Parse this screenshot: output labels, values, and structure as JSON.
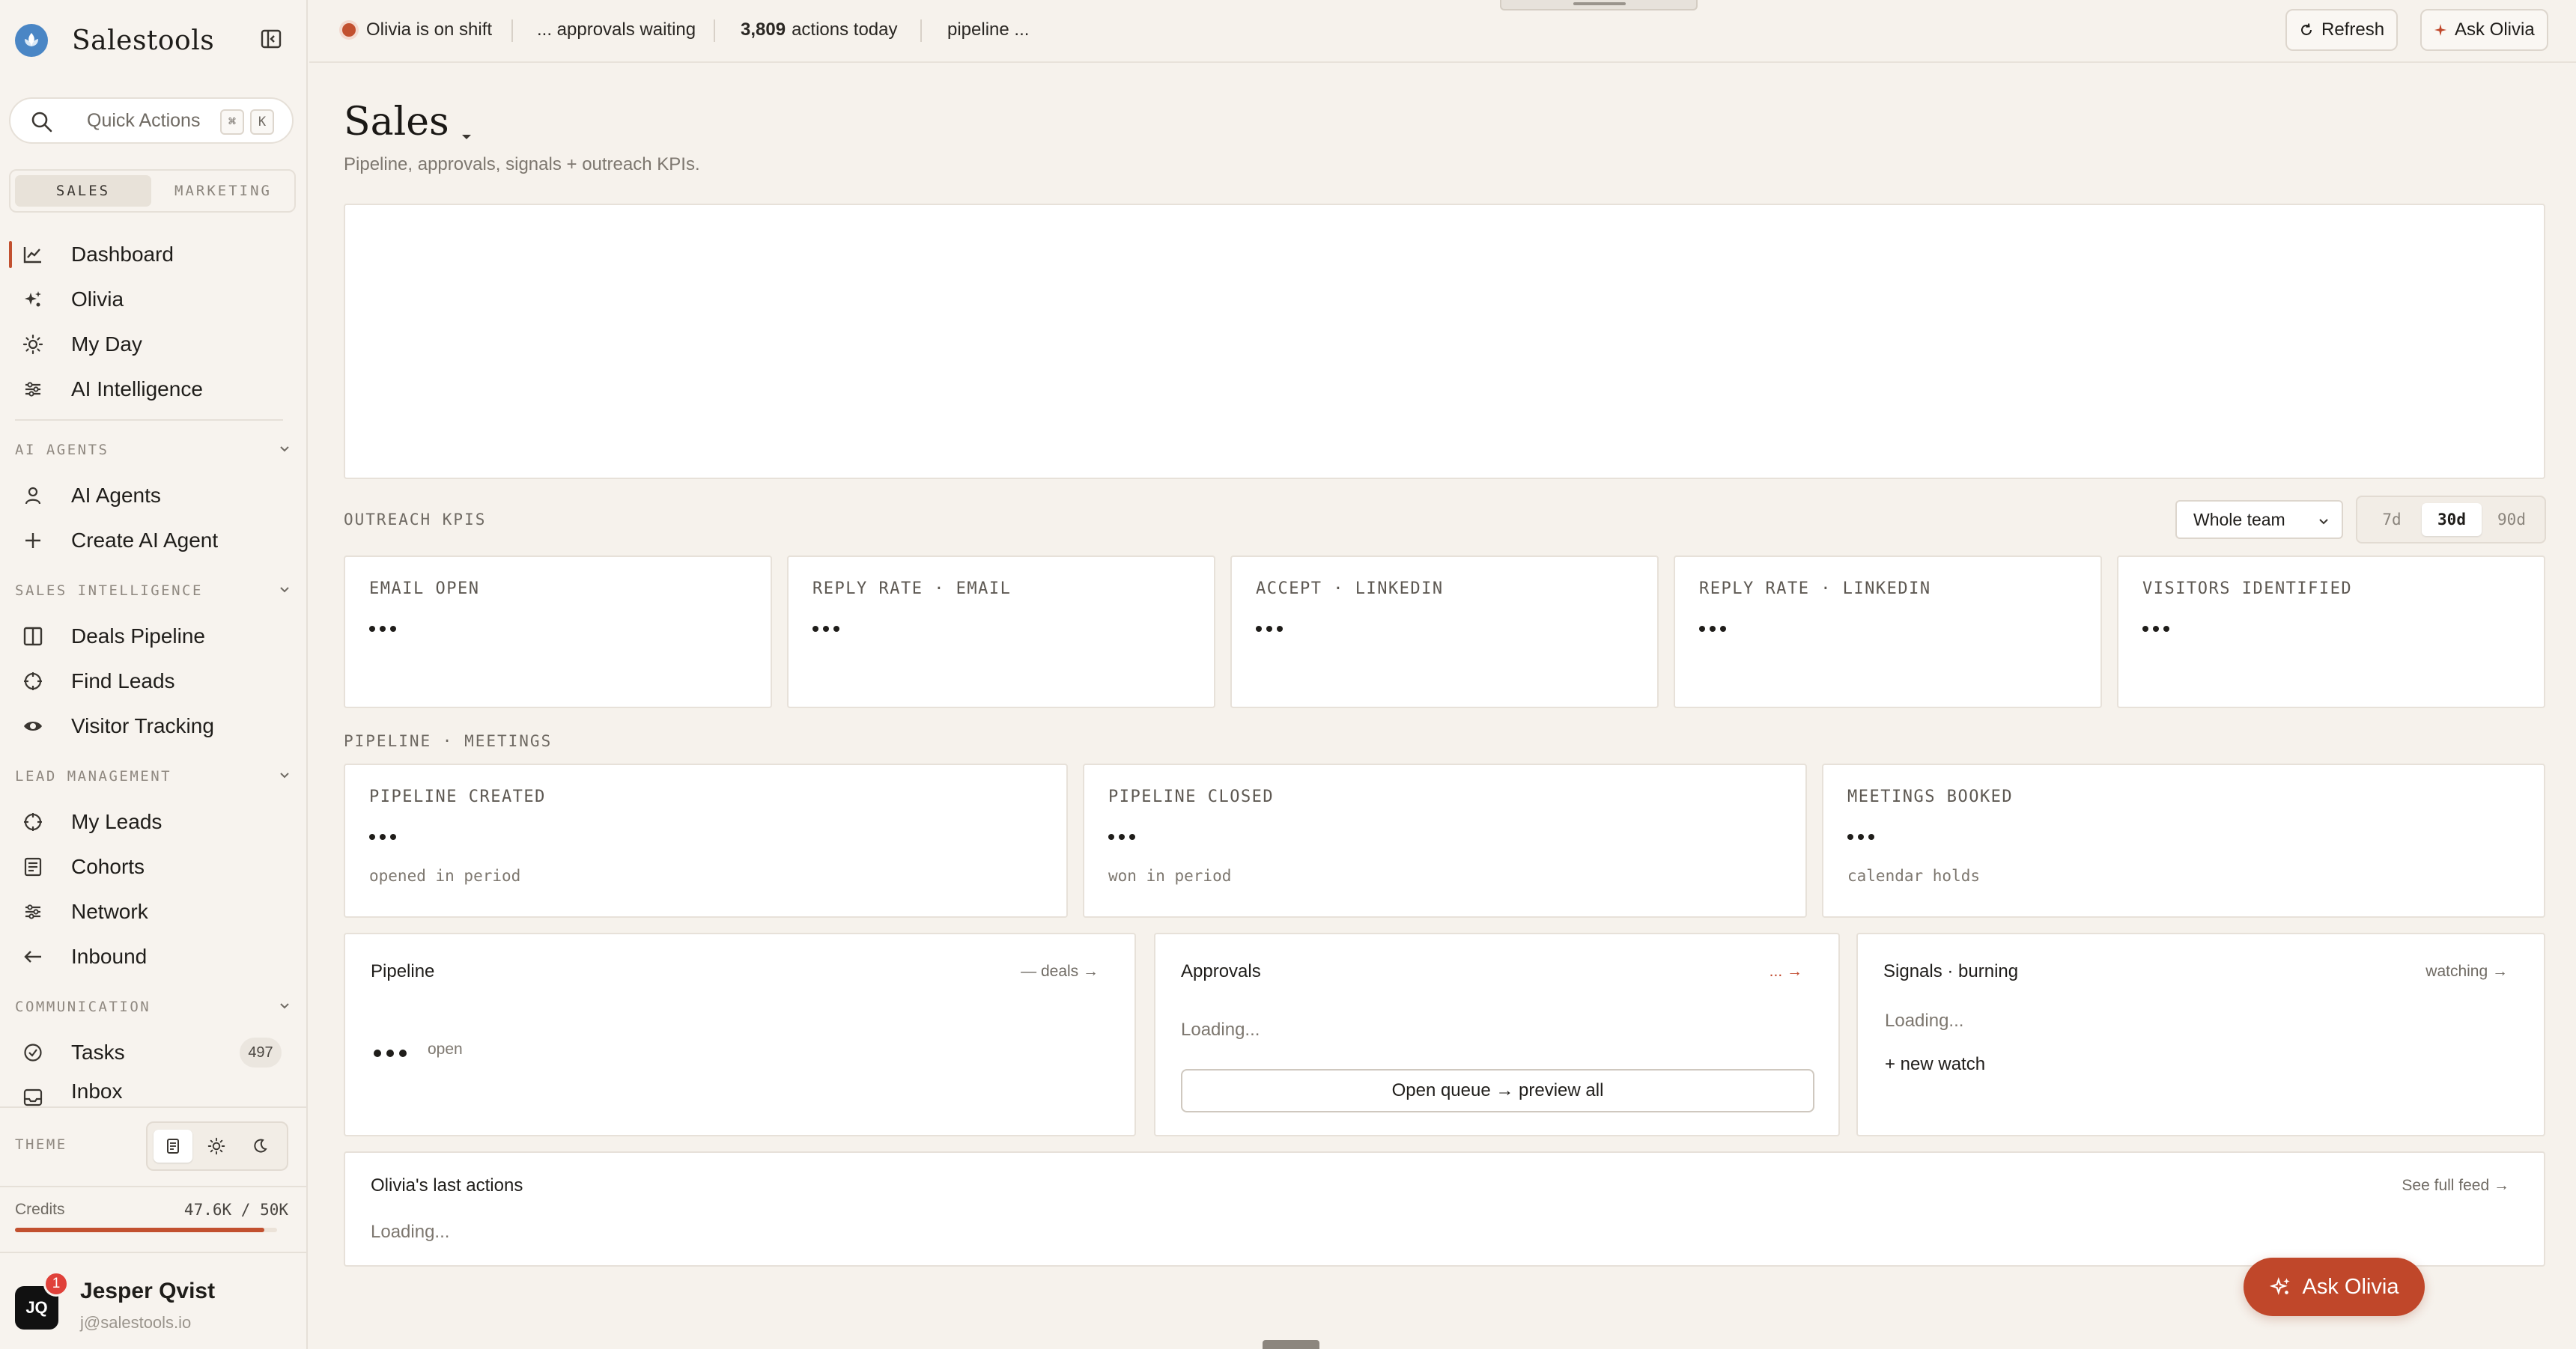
{
  "app": {
    "name": "Salestools"
  },
  "sidebar": {
    "quick_actions": {
      "label": "Quick Actions",
      "kbd1": "⌘",
      "kbd2": "K"
    },
    "workspace_tabs": [
      "SALES",
      "MARKETING"
    ],
    "primary": [
      {
        "label": "Dashboard",
        "icon": "chart-line-icon",
        "active": true
      },
      {
        "label": "Olivia",
        "icon": "sparkles-icon"
      },
      {
        "label": "My Day",
        "icon": "sun-icon"
      },
      {
        "label": "AI Intelligence",
        "icon": "sliders-icon"
      }
    ],
    "sections": [
      {
        "title": "AI AGENTS",
        "items": [
          {
            "label": "AI Agents",
            "icon": "user-icon"
          },
          {
            "label": "Create AI Agent",
            "icon": "plus-icon"
          }
        ]
      },
      {
        "title": "SALES INTELLIGENCE",
        "items": [
          {
            "label": "Deals Pipeline",
            "icon": "columns-icon"
          },
          {
            "label": "Find Leads",
            "icon": "crosshair-icon"
          },
          {
            "label": "Visitor Tracking",
            "icon": "eye-icon"
          }
        ]
      },
      {
        "title": "LEAD MANAGEMENT",
        "items": [
          {
            "label": "My Leads",
            "icon": "crosshair-icon"
          },
          {
            "label": "Cohorts",
            "icon": "document-icon"
          },
          {
            "label": "Network",
            "icon": "sliders-icon"
          },
          {
            "label": "Inbound",
            "icon": "arrow-left-icon"
          }
        ]
      },
      {
        "title": "COMMUNICATION",
        "items": [
          {
            "label": "Tasks",
            "icon": "check-circle-icon",
            "count": "497"
          },
          {
            "label": "Inbox",
            "icon": "inbox-icon"
          }
        ]
      }
    ],
    "theme_label": "THEME",
    "credits": {
      "label": "Credits",
      "value": "47.6K / 50K",
      "used_fraction": 0.952
    },
    "user": {
      "initials": "JQ",
      "name": "Jesper Qvist",
      "email": "j@salestools.io",
      "notifications": "1"
    }
  },
  "topbar": {
    "shift": "Olivia is on shift",
    "approvals": "... approvals waiting",
    "actions_count": "3,809",
    "actions_label": "actions today",
    "pipeline": "pipeline ...",
    "refresh": "Refresh",
    "ask": "Ask Olivia"
  },
  "page": {
    "title": "Sales",
    "subtitle": "Pipeline, approvals, signals + outreach KPIs."
  },
  "outreach": {
    "label": "OUTREACH KPIS",
    "team_select": "Whole team",
    "ranges": [
      "7d",
      "30d",
      "90d"
    ],
    "active_range": "30d",
    "kpis": [
      "EMAIL OPEN",
      "REPLY RATE · EMAIL",
      "ACCEPT · LINKEDIN",
      "REPLY RATE · LINKEDIN",
      "VISITORS IDENTIFIED"
    ]
  },
  "pipeline_meetings": {
    "label": "PIPELINE · MEETINGS",
    "cards": [
      {
        "title": "PIPELINE CREATED",
        "sub": "opened in period"
      },
      {
        "title": "PIPELINE CLOSED",
        "sub": "won in period"
      },
      {
        "title": "MEETINGS BOOKED",
        "sub": "calendar holds"
      }
    ]
  },
  "panels": {
    "pipeline": {
      "title": "Pipeline",
      "link": "— deals →",
      "sub": "open"
    },
    "approvals": {
      "title": "Approvals",
      "link": "... →",
      "loading": "Loading...",
      "button": "Open queue → preview all"
    },
    "signals": {
      "title": "Signals · burning",
      "link": "watching →",
      "loading": "Loading...",
      "new_watch": "+ new watch"
    },
    "actions": {
      "title": "Olivia's last actions",
      "link": "See full feed →",
      "loading": "Loading..."
    }
  },
  "fab": {
    "label": "Ask Olivia"
  },
  "colors": {
    "accent": "#c0472a",
    "brand": "#4a86c5",
    "background": "#f6f2ec"
  }
}
